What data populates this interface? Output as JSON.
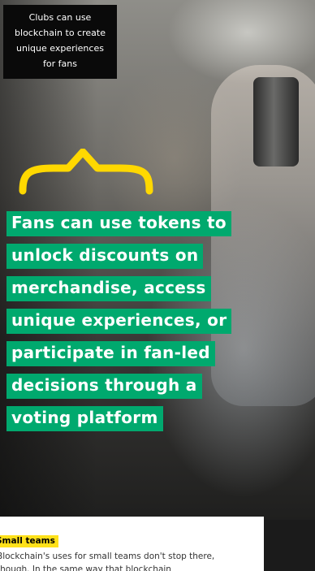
{
  "caption": {
    "lines": [
      "Clubs can use",
      "blockchain to create",
      "unique experiences",
      "for fans"
    ]
  },
  "quote": {
    "lines": [
      "Fans can use tokens to",
      "unlock discounts on",
      "merchandise, access",
      "unique experiences, or",
      "participate in fan-led",
      "decisions through a",
      "voting platform"
    ]
  },
  "section": {
    "heading": "Small teams",
    "body": "Blockchain's uses for small teams don't stop there, though. In the same way that blockchain"
  },
  "colors": {
    "highlight_green": "#00a96e",
    "brace_yellow": "#ffd800",
    "heading_yellow": "#ffe11a"
  }
}
